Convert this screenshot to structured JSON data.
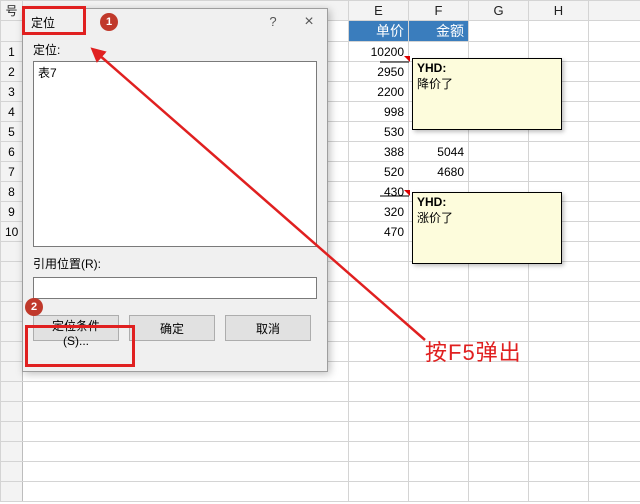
{
  "columns": {
    "corner": "号",
    "E": "E",
    "F": "F",
    "G": "G",
    "H": "H"
  },
  "headers": {
    "price": "单价",
    "amount": "金额"
  },
  "rows": [
    {
      "n": 1,
      "price": 10200,
      "amount": ""
    },
    {
      "n": 2,
      "price": 2950,
      "amount": ""
    },
    {
      "n": 3,
      "price": 2200,
      "amount": ""
    },
    {
      "n": 4,
      "price": 998,
      "amount": ""
    },
    {
      "n": 5,
      "price": 530,
      "amount": ""
    },
    {
      "n": 6,
      "price": 388,
      "amount": 5044
    },
    {
      "n": 7,
      "price": 520,
      "amount": 4680
    },
    {
      "n": 8,
      "price": 430,
      "amount": ""
    },
    {
      "n": 9,
      "price": 320,
      "amount": ""
    },
    {
      "n": 10,
      "price": 470,
      "amount": ""
    }
  ],
  "dialog": {
    "title": "定位",
    "goto_label": "定位:",
    "list_item": "表7",
    "ref_label": "引用位置(R):",
    "ref_value": "",
    "btn_conditions": "定位条件(S)...",
    "btn_ok": "确定",
    "btn_cancel": "取消"
  },
  "notes": {
    "author": "YHD:",
    "note1": "降价了",
    "note2": "涨价了"
  },
  "markers": {
    "m1": "1",
    "m2": "2"
  },
  "annotation": "按F5弹出"
}
